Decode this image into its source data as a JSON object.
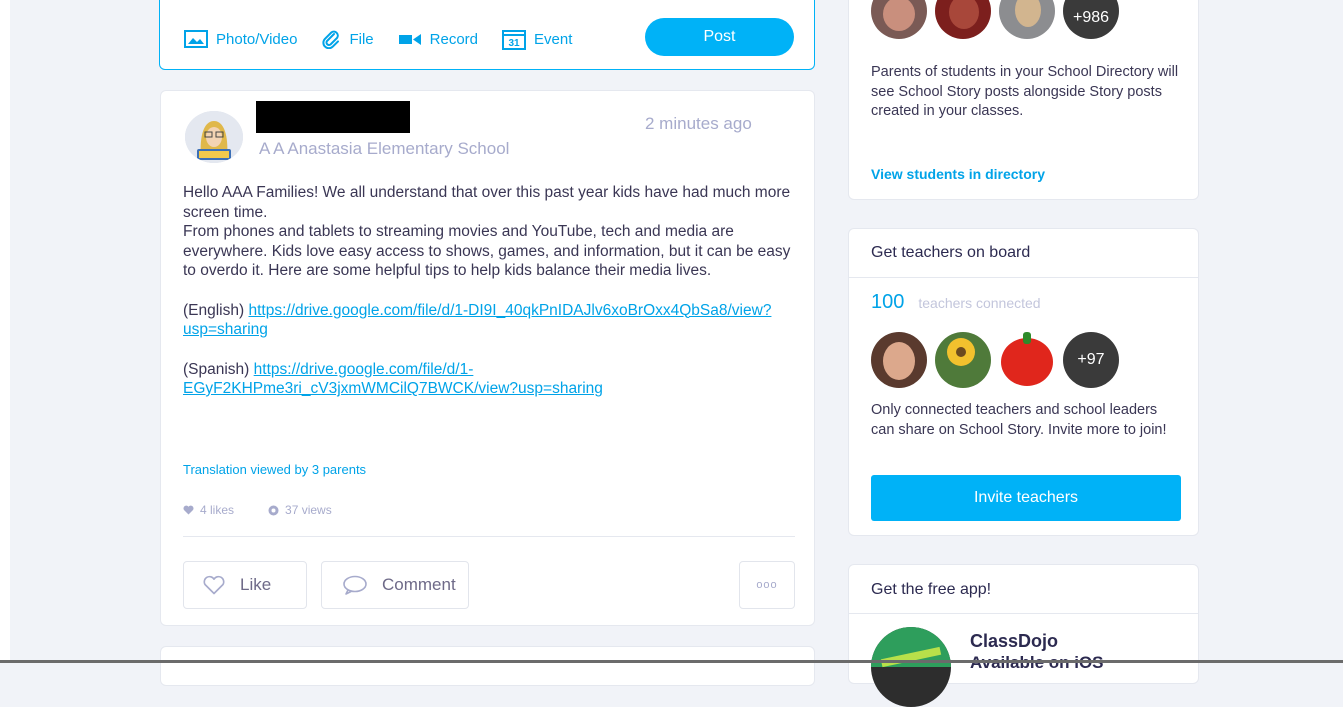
{
  "composer": {
    "photo_video": "Photo/Video",
    "file": "File",
    "record": "Record",
    "event": "Event",
    "calendar_day": "31",
    "post": "Post"
  },
  "post": {
    "school": "A A Anastasia Elementary School",
    "time": "2 minutes ago",
    "body_lines": [
      "Hello AAA Families! We all understand that over this past year kids have had much more screen time.",
      "From phones and tablets to streaming movies and YouTube, tech and media are everywhere. Kids love easy access to shows, games, and information, but it can be easy to overdo it. Here are some helpful tips to help kids balance their media lives."
    ],
    "english_label": "(English)",
    "english_link": "https://drive.google.com/file/d/1-DI9I_40qkPnIDAJlv6xoBrOxx4QbSa8/view?usp=sharing",
    "spanish_label": "(Spanish)",
    "spanish_link": "https://drive.google.com/file/d/1-EGyF2KHPme3ri_cV3jxmWMCilQ7BWCK/view?usp=sharing",
    "translation": "Translation viewed by 3 parents",
    "likes": "4 likes",
    "views": "37 views",
    "like_label": "Like",
    "comment_label": "Comment",
    "more_label": "ooo"
  },
  "directory_card": {
    "more_count": "+986",
    "text": "Parents of students in your School Directory will see School Story posts alongside Story posts created in your classes.",
    "link": "View students in directory"
  },
  "teachers_card": {
    "title": "Get teachers on board",
    "count": "100",
    "count_label": "teachers connected",
    "more_count": "+97",
    "text": "Only connected teachers and school leaders can share on School Story. Invite more to join!",
    "invite": "Invite teachers"
  },
  "app_card": {
    "title": "Get the free app!",
    "app_name": "ClassDojo",
    "app_sub": "Available on iOS"
  },
  "colors": {
    "accent": "#00b2f7",
    "link": "#00a3e8",
    "muted": "#a7abcc",
    "background": "#f1f3f8"
  }
}
